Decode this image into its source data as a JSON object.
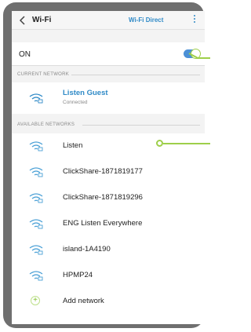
{
  "header": {
    "title": "Wi-Fi",
    "wifi_direct_label": "Wi-Fi Direct"
  },
  "wifi_toggle": {
    "label": "ON",
    "enabled": true
  },
  "sections": {
    "current_network": "CURRENT NETWORK",
    "available_networks": "AVAILABLE NETWORKS"
  },
  "current_network": {
    "name": "Listen Guest",
    "status": "Connected"
  },
  "available": [
    {
      "name": "Listen"
    },
    {
      "name": "ClickShare-1871819177"
    },
    {
      "name": "ClickShare-1871819296"
    },
    {
      "name": "ENG Listen Everywhere"
    },
    {
      "name": "island-1A4190"
    },
    {
      "name": "HPMP24"
    }
  ],
  "add_network_label": "Add network",
  "colors": {
    "accent": "#2f8ac7",
    "toggle": "#4c90d6",
    "callout": "#9ecf4a",
    "frame": "#6f6f6f"
  }
}
